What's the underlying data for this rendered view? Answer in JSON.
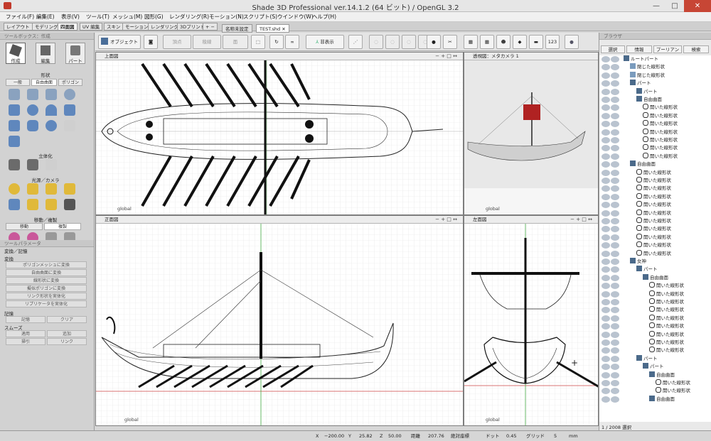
{
  "window": {
    "title": "Shade 3D Professional ver.14.1.2 (64 ビット) / OpenGL 3.2"
  },
  "menu": [
    "ファイル(F)",
    "編集(E)",
    "表示(V)",
    "ツール(T)",
    "メッシュ(M)",
    "図形(G)",
    "レンダリング(R)",
    "モーション(N)",
    "スクリプト(S)",
    "ウインドウ(W)",
    "ヘルプ(H)"
  ],
  "layout_tabs": [
    "レイアウト",
    "モデリング",
    "四面図",
    "UV 編集",
    "スキン",
    "モーション",
    "レンダリング",
    "3Dプリント",
    "+ −"
  ],
  "doc_tabs": [
    "名称未設定",
    "TEST.shd"
  ],
  "toolbox": {
    "title": "ツールボックス：作成",
    "modes": [
      "作成",
      "編集",
      "パート"
    ],
    "shape_label": "形状",
    "shape_tabs": [
      "一般",
      "自由曲面",
      "ポリゴン"
    ],
    "solid_label": "立体化",
    "light_label": "光源／カメラ",
    "move_label": "移動／複製",
    "move_tabs": [
      "移動",
      "複製"
    ]
  },
  "params": {
    "title": "ツールパラメータ",
    "section": "変換／記憶",
    "convert_label": "変換",
    "convert_buttons": [
      "ポリゴンメッシュに変換",
      "自由曲面に変換",
      "線形状に変換",
      "擬似ポリゴンに変換",
      "リンク形状を実体化",
      "リプリケータを実体化"
    ],
    "memory_label": "記憶",
    "memory_buttons": [
      "記憶",
      "クリア"
    ],
    "smooth_label": "スムーズ",
    "smooth_buttons": [
      "適用",
      "追加",
      "掃引",
      "リンク"
    ]
  },
  "toolbar": {
    "object": "オブジェクト",
    "vertex": "頂点",
    "edge": "稜線",
    "face": "面",
    "hide": "非表示",
    "num": "123"
  },
  "views": {
    "top": "上面図",
    "persp": "透視図：メタカメラ 1",
    "front": "正面図",
    "side": "左面図",
    "global": "global",
    "controls": "− + □ ↔"
  },
  "browser": {
    "title": "ブラウザ",
    "tabs": [
      "選択",
      "情報",
      "プーリアン",
      "検索"
    ],
    "tree": [
      {
        "label": "ルートパート",
        "depth": 0,
        "type": "part"
      },
      {
        "label": "閉じた線形状",
        "depth": 1,
        "type": "line"
      },
      {
        "label": "閉じた線形状",
        "depth": 1,
        "type": "line"
      },
      {
        "label": "パート",
        "depth": 1,
        "type": "part"
      },
      {
        "label": "パート",
        "depth": 2,
        "type": "part"
      },
      {
        "label": "自由曲面",
        "depth": 2,
        "type": "part"
      },
      {
        "label": "開いた線形状",
        "depth": 3,
        "type": "curve"
      },
      {
        "label": "開いた線形状",
        "depth": 3,
        "type": "curve"
      },
      {
        "label": "開いた線形状",
        "depth": 3,
        "type": "curve"
      },
      {
        "label": "開いた線形状",
        "depth": 3,
        "type": "curve"
      },
      {
        "label": "開いた線形状",
        "depth": 3,
        "type": "curve"
      },
      {
        "label": "開いた線形状",
        "depth": 3,
        "type": "curve"
      },
      {
        "label": "開いた線形状",
        "depth": 3,
        "type": "curve"
      },
      {
        "label": "自由曲面",
        "depth": 1,
        "type": "part"
      },
      {
        "label": "開いた線形状",
        "depth": 2,
        "type": "curve"
      },
      {
        "label": "開いた線形状",
        "depth": 2,
        "type": "curve"
      },
      {
        "label": "開いた線形状",
        "depth": 2,
        "type": "curve"
      },
      {
        "label": "開いた線形状",
        "depth": 2,
        "type": "curve"
      },
      {
        "label": "開いた線形状",
        "depth": 2,
        "type": "curve"
      },
      {
        "label": "開いた線形状",
        "depth": 2,
        "type": "curve"
      },
      {
        "label": "開いた線形状",
        "depth": 2,
        "type": "curve"
      },
      {
        "label": "開いた線形状",
        "depth": 2,
        "type": "curve"
      },
      {
        "label": "開いた線形状",
        "depth": 2,
        "type": "curve"
      },
      {
        "label": "開いた線形状",
        "depth": 2,
        "type": "curve"
      },
      {
        "label": "開いた線形状",
        "depth": 2,
        "type": "curve"
      },
      {
        "label": "女神",
        "depth": 1,
        "type": "part"
      },
      {
        "label": "パート",
        "depth": 2,
        "type": "part"
      },
      {
        "label": "自由曲面",
        "depth": 3,
        "type": "part"
      },
      {
        "label": "開いた線形状",
        "depth": 4,
        "type": "curve"
      },
      {
        "label": "開いた線形状",
        "depth": 4,
        "type": "curve"
      },
      {
        "label": "開いた線形状",
        "depth": 4,
        "type": "curve"
      },
      {
        "label": "開いた線形状",
        "depth": 4,
        "type": "curve"
      },
      {
        "label": "開いた線形状",
        "depth": 4,
        "type": "curve"
      },
      {
        "label": "開いた線形状",
        "depth": 4,
        "type": "curve"
      },
      {
        "label": "開いた線形状",
        "depth": 4,
        "type": "curve"
      },
      {
        "label": "開いた線形状",
        "depth": 4,
        "type": "curve"
      },
      {
        "label": "開いた線形状",
        "depth": 4,
        "type": "curve"
      },
      {
        "label": "パート",
        "depth": 2,
        "type": "part"
      },
      {
        "label": "パート",
        "depth": 3,
        "type": "part"
      },
      {
        "label": "自由曲面",
        "depth": 4,
        "type": "part"
      },
      {
        "label": "開いた線形状",
        "depth": 5,
        "type": "curve"
      },
      {
        "label": "開いた線形状",
        "depth": 5,
        "type": "curve"
      },
      {
        "label": "自由曲面",
        "depth": 4,
        "type": "part"
      }
    ],
    "footer": "1 / 2008 選択"
  },
  "status": {
    "x_label": "X",
    "x": "−200.00",
    "y_label": "Y",
    "y": "25.82",
    "z_label": "Z",
    "z": "50.00",
    "dist_label": "距離",
    "dist": "207.76",
    "abs_label": "絶対座標",
    "dot_label": "ドット",
    "dot": "0.45",
    "grid_label": "グリッド",
    "grid": "5",
    "unit": "mm"
  }
}
